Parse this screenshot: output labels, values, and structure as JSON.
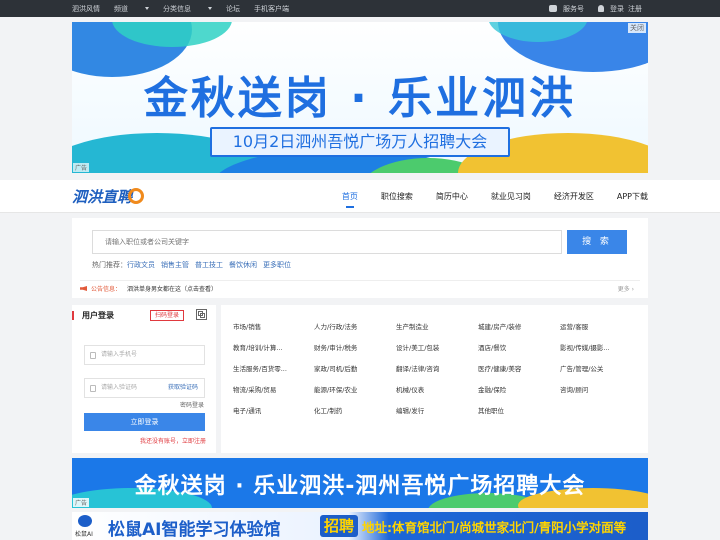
{
  "topbar": {
    "left": [
      "泗洪风情",
      "频道",
      "分类信息",
      "论坛",
      "手机客户端"
    ],
    "service": "服务号",
    "login": "登录",
    "register": "注册"
  },
  "banner1": {
    "title": "金秋送岗 · 乐业泗洪",
    "subtitle": "10月2日泗州吾悦广场万人招聘大会",
    "close": "关闭",
    "ad": "广告"
  },
  "header": {
    "logo": "泗洪直聘",
    "nav": [
      "首页",
      "职位搜索",
      "简历中心",
      "就业见习岗",
      "经济开发区",
      "APP下载"
    ]
  },
  "search": {
    "placeholder": "请输入职位或者公司关键字",
    "button": "搜 索",
    "hot_label": "热门推荐：",
    "hot": [
      "行政文员",
      "销售主管",
      "普工技工",
      "餐饮休闲",
      "更多职位"
    ]
  },
  "notice": {
    "tag": "公告信息：",
    "text": "泗洪单身男女都在这（点击查看）",
    "more": "更多 ›"
  },
  "login": {
    "title": "用户登录",
    "qr": "扫码登录",
    "phone_placeholder": "请输入手机号",
    "code_placeholder": "请输入验证码",
    "get_code": "获取验证码",
    "pwd_login": "密码登录",
    "submit": "立即登录",
    "register": "我还没有账号，立即注册"
  },
  "categories": [
    [
      "市场/销售",
      "人力/行政/法务",
      "生产制造业",
      "城建/房产/装修",
      "运营/客服"
    ],
    [
      "教育/培训/计算...",
      "财务/审计/税务",
      "设计/美工/包装",
      "酒店/餐饮",
      "影视/传媒/摄影..."
    ],
    [
      "生活服务/百货零...",
      "家政/司机/后勤",
      "翻译/法律/咨询",
      "医疗/健康/美容",
      "广告/管理/公关"
    ],
    [
      "物流/采购/贸易",
      "能源/环保/农业",
      "机械/仪表",
      "金融/保险",
      "咨询/顾问"
    ],
    [
      "电子/通讯",
      "化工/制药",
      "编辑/发行",
      "其他职位"
    ]
  ],
  "banner2": {
    "text": "金秋送岗 · 乐业泗洪-泗州吾悦广场招聘大会",
    "ad": "广告"
  },
  "banner3": {
    "brand": "松鼠AI",
    "title": "松鼠AI智能学习体验馆",
    "tag": "招聘",
    "address": "地址:体育馆北门/尚城世家北门/青阳小学对面等"
  }
}
